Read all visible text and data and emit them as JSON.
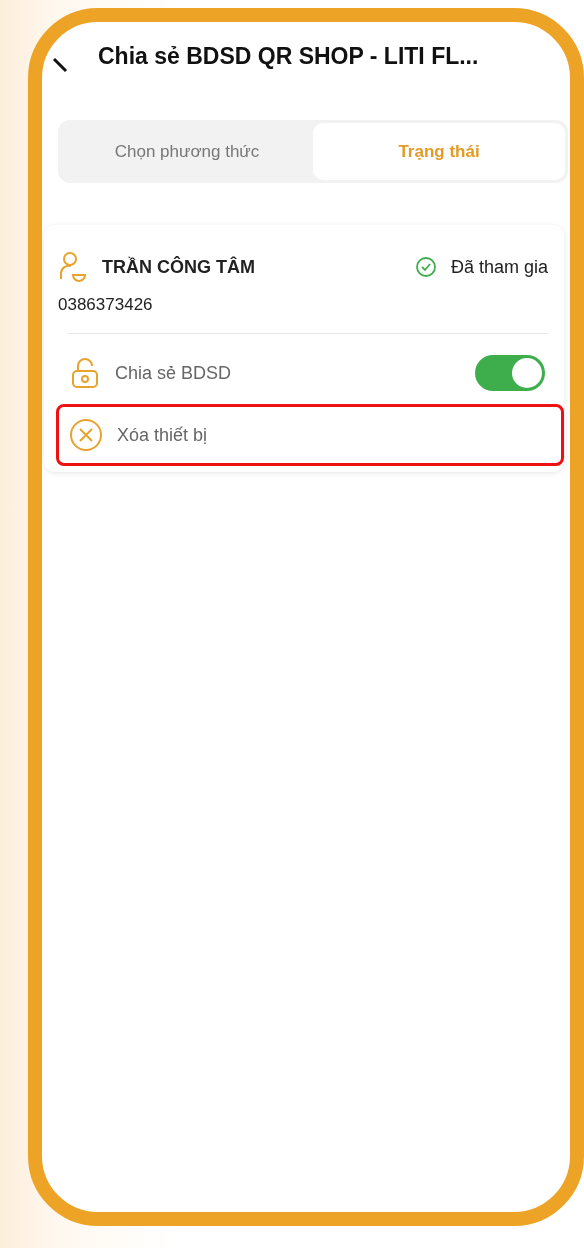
{
  "header": {
    "title": "Chia sẻ BDSD QR SHOP - LITI FL..."
  },
  "tabs": [
    {
      "label": "Chọn phương thức",
      "selected": false
    },
    {
      "label": "Trạng thái",
      "selected": true
    }
  ],
  "member": {
    "name": "TRẦN CÔNG TÂM",
    "status": "Đã tham gia",
    "phone": "0386373426"
  },
  "options": [
    {
      "kind": "toggle",
      "label": "Chia sẻ BDSD",
      "on": true,
      "highlighted": false
    },
    {
      "kind": "action",
      "label": "Xóa thiết bị",
      "highlighted": true
    }
  ]
}
